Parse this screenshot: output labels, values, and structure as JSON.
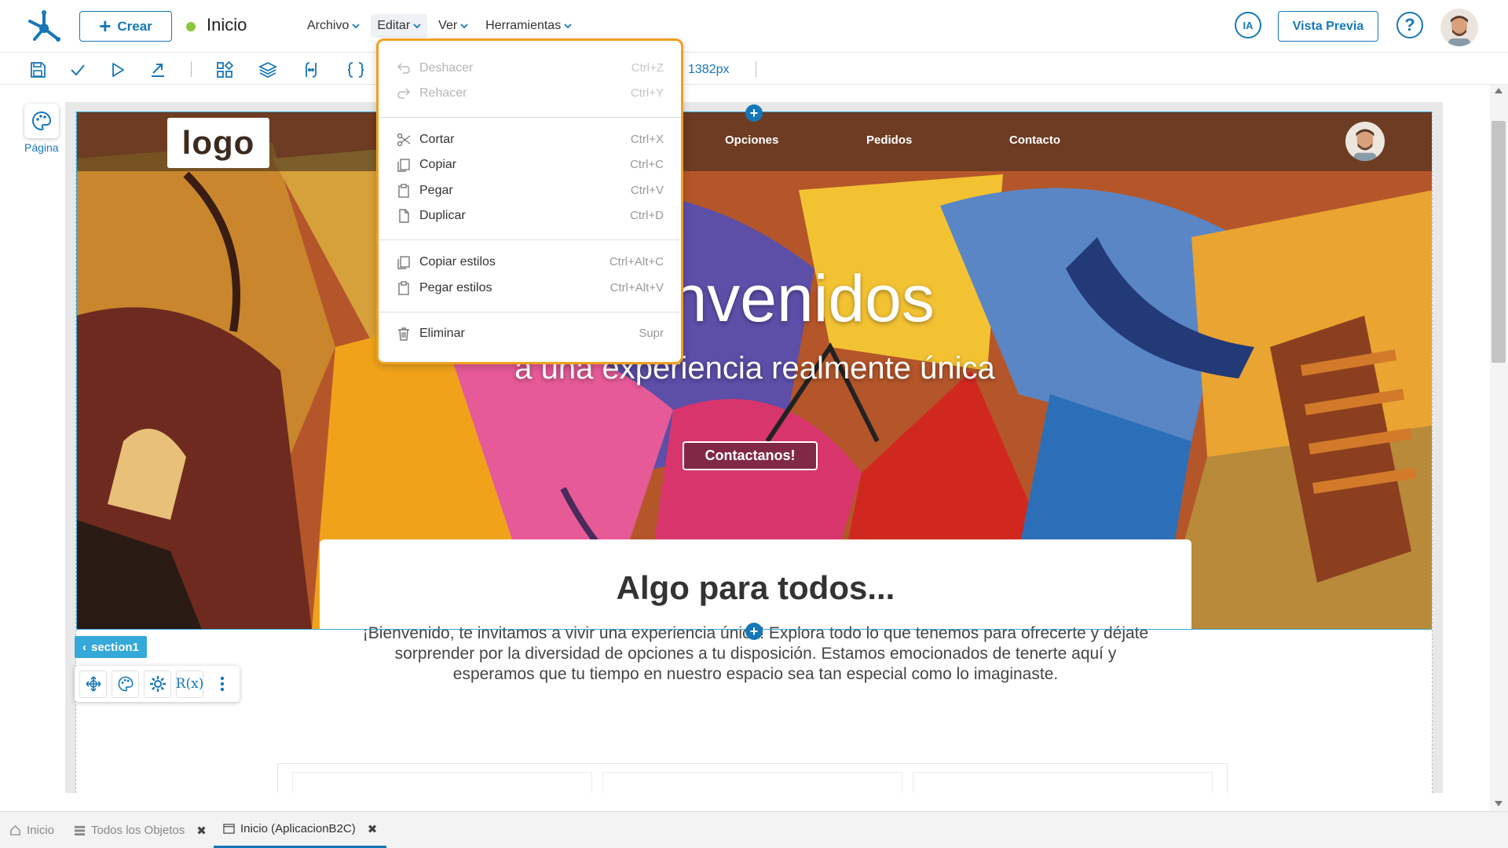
{
  "header": {
    "create_label": "Crear",
    "page_title": "Inicio",
    "menus": [
      {
        "label": "Archivo"
      },
      {
        "label": "Editar"
      },
      {
        "label": "Ver"
      },
      {
        "label": "Herramientas"
      }
    ],
    "ia_label": "IA",
    "preview_label": "Vista Previa",
    "help_label": "?"
  },
  "toolbar": {
    "width_readout": "1382px"
  },
  "left_rail": {
    "page_label": "Página"
  },
  "edit_menu": {
    "items": [
      {
        "label": "Deshacer",
        "shortcut": "Ctrl+Z",
        "icon": "undo-icon",
        "disabled": true
      },
      {
        "label": "Rehacer",
        "shortcut": "Ctrl+Y",
        "icon": "redo-icon",
        "disabled": true
      },
      {
        "label": "Cortar",
        "shortcut": "Ctrl+X",
        "icon": "scissors-icon",
        "disabled": false
      },
      {
        "label": "Copiar",
        "shortcut": "Ctrl+C",
        "icon": "copy-icon",
        "disabled": false
      },
      {
        "label": "Pegar",
        "shortcut": "Ctrl+V",
        "icon": "clipboard-icon",
        "disabled": false
      },
      {
        "label": "Duplicar",
        "shortcut": "Ctrl+D",
        "icon": "duplicate-icon",
        "disabled": false
      },
      {
        "label": "Copiar estilos",
        "shortcut": "Ctrl+Alt+C",
        "icon": "copy-styles-icon",
        "disabled": false
      },
      {
        "label": "Pegar estilos",
        "shortcut": "Ctrl+Alt+V",
        "icon": "paste-styles-icon",
        "disabled": false
      },
      {
        "label": "Eliminar",
        "shortcut": "Supr",
        "icon": "trash-icon",
        "disabled": false
      }
    ]
  },
  "site": {
    "logo_text": "logo",
    "nav": [
      "Opciones",
      "Pedidos",
      "Contacto"
    ],
    "hero_title": "Bienvenidos",
    "hero_subtitle": "a una experiencia realmente única",
    "hero_cta": "Contactanos!",
    "card_title": "Algo para todos...",
    "card_text": "¡Bienvenido, te invitamos a vivir una experiencia única! Explora todo lo que tenemos para ofrecerte y déjate sorprender por la diversidad de opciones a tu disposición. Estamos emocionados de tenerte aquí y esperamos que tu tiempo en nuestro espacio sea tan especial como lo imaginaste."
  },
  "selection": {
    "tag": "section1",
    "rx_label": "R(x)"
  },
  "bottom_tabs": [
    {
      "label": "Inicio",
      "icon": "home-icon"
    },
    {
      "label": "Todos los Objetos",
      "icon": "list-icon"
    },
    {
      "label": "Inicio (AplicacionB2C)",
      "icon": "page-icon"
    }
  ],
  "colors": {
    "accent": "#1677b8",
    "selection": "#35a9d9",
    "menu_highlight": "#f0a020",
    "status_ok": "#8dc63f"
  }
}
